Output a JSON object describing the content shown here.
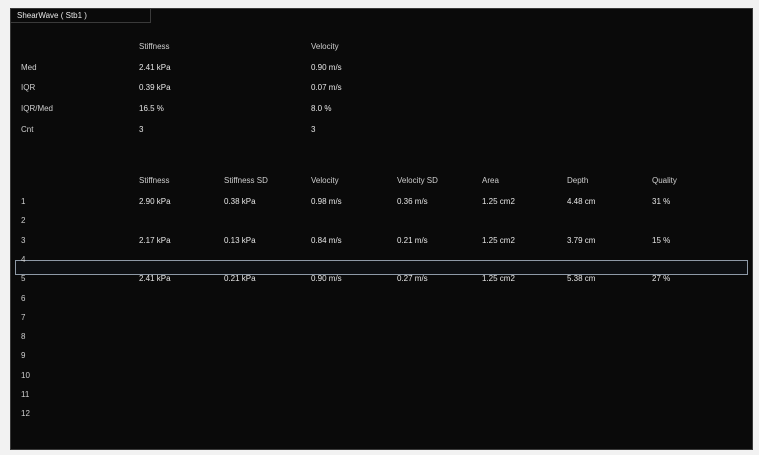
{
  "title": "ShearWave ( Stb1 )",
  "summary": {
    "headers": [
      "Stiffness",
      "Velocity"
    ],
    "rows": [
      {
        "label": "Med",
        "stiffness": "2.41 kPa",
        "velocity": "0.90 m/s"
      },
      {
        "label": "IQR",
        "stiffness": "0.39 kPa",
        "velocity": "0.07 m/s"
      },
      {
        "label": "IQR/Med",
        "stiffness": "16.5 %",
        "velocity": "8.0 %"
      },
      {
        "label": "Cnt",
        "stiffness": "3",
        "velocity": "3"
      }
    ]
  },
  "measurements": {
    "headers": [
      "Stiffness",
      "Stiffness SD",
      "Velocity",
      "Velocity SD",
      "Area",
      "Depth",
      "Quality"
    ],
    "rows": [
      {
        "index": "1",
        "values": [
          "2.90 kPa",
          "0.38 kPa",
          "0.98 m/s",
          "0.36 m/s",
          "1.25 cm2",
          "4.48 cm",
          "31 %"
        ]
      },
      {
        "index": "2",
        "values": [
          "",
          "",
          "",
          "",
          "",
          "",
          ""
        ]
      },
      {
        "index": "3",
        "values": [
          "2.17 kPa",
          "0.13 kPa",
          "0.84 m/s",
          "0.21 m/s",
          "1.25 cm2",
          "3.79 cm",
          "15 %"
        ]
      },
      {
        "index": "4",
        "values": [
          "",
          "",
          "",
          "",
          "",
          "",
          ""
        ]
      },
      {
        "index": "5",
        "values": [
          "2.41 kPa",
          "0.21 kPa",
          "0.90 m/s",
          "0.27 m/s",
          "1.25 cm2",
          "5.38 cm",
          "27 %"
        ]
      },
      {
        "index": "6",
        "values": [
          "",
          "",
          "",
          "",
          "",
          "",
          ""
        ]
      },
      {
        "index": "7",
        "values": [
          "",
          "",
          "",
          "",
          "",
          "",
          ""
        ]
      },
      {
        "index": "8",
        "values": [
          "",
          "",
          "",
          "",
          "",
          "",
          ""
        ]
      },
      {
        "index": "9",
        "values": [
          "",
          "",
          "",
          "",
          "",
          "",
          ""
        ]
      },
      {
        "index": "10",
        "values": [
          "",
          "",
          "",
          "",
          "",
          "",
          ""
        ]
      },
      {
        "index": "11",
        "values": [
          "",
          "",
          "",
          "",
          "",
          "",
          ""
        ]
      },
      {
        "index": "12",
        "values": [
          "",
          "",
          "",
          "",
          "",
          "",
          ""
        ]
      }
    ]
  }
}
